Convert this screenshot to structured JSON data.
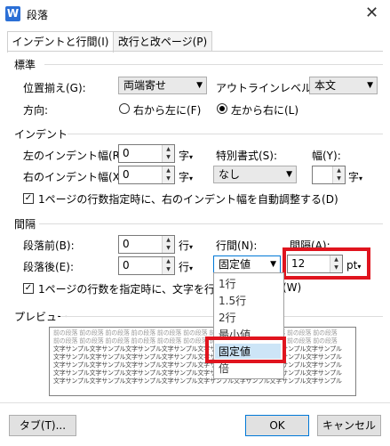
{
  "window": {
    "title": "段落",
    "close_glyph": "✕",
    "app_icon_letter": "W"
  },
  "tabs": [
    {
      "label": "インデントと行間(I)",
      "active": true
    },
    {
      "label": "改行と改ページ(P)",
      "active": false
    }
  ],
  "general": {
    "section": "標準",
    "alignment_label": "位置揃え(G):",
    "alignment_value": "両端寄せ",
    "outline_label": "アウトラインレベル(O):",
    "outline_value": "本文",
    "direction_label": "方向:",
    "rtl_label": "右から左に(F)",
    "ltr_label": "左から右に(L)",
    "selected_direction": "ltr"
  },
  "indent": {
    "section": "インデント",
    "left_label": "左のインデント幅(R):",
    "left_value": "0",
    "left_unit": "字",
    "right_label": "右のインデント幅(X):",
    "right_value": "0",
    "right_unit": "字",
    "special_label": "特別書式(S):",
    "special_value": "なし",
    "width_label": "幅(Y):",
    "width_value": "",
    "width_unit": "字",
    "auto_adjust_label": "1ページの行数指定時に、右のインデント幅を自動調整する(D)",
    "auto_adjust_checked": true
  },
  "spacing": {
    "section": "間隔",
    "before_label": "段落前(B):",
    "before_value": "0",
    "before_unit": "行",
    "after_label": "段落後(E):",
    "after_value": "0",
    "after_unit": "行",
    "line_label": "行間(N):",
    "line_value": "固定値",
    "at_label": "間隔(A):",
    "at_value": "12",
    "at_unit": "pt",
    "grid_label": "1ページの行数を指定時に、文字を行グリッド",
    "grid_label_tail": "(W)",
    "grid_checked": true
  },
  "line_options": [
    "1行",
    "1.5行",
    "2行",
    "最小値",
    "固定値",
    "倍"
  ],
  "line_selected": "固定値",
  "preview": {
    "section": "プレビュー",
    "prev_line": "前の段落 前の段落 前の段落 前の段落 前の段落 前の段落 前の段落 前の段落 前の段落 前の段落 前の段落",
    "sample_line": "文字サンプル文字サンプル文字サンプル文字サンプル文字サンプル文字サンプル文字サンプル文字サンプル"
  },
  "buttons": {
    "tab": "タブ(T)...",
    "ok": "OK",
    "cancel": "キャンセル"
  },
  "colors": {
    "highlight": "#e0141e",
    "accent": "#2b6fd6"
  }
}
